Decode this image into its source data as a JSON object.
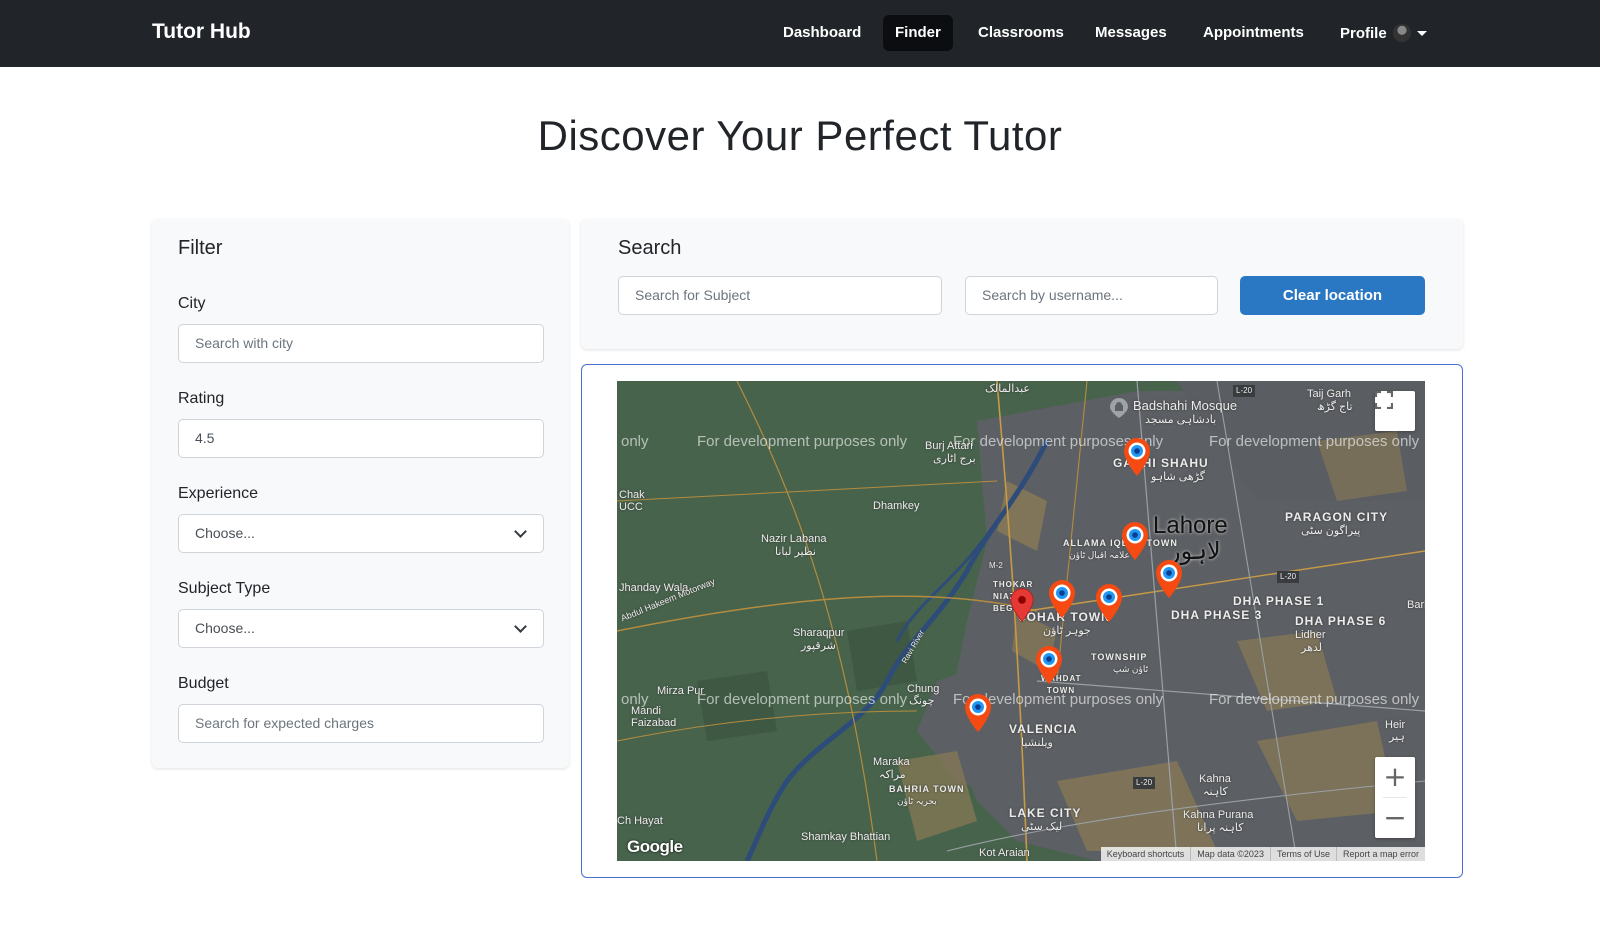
{
  "nav": {
    "brand": "Tutor Hub",
    "links": [
      "Dashboard",
      "Finder",
      "Classrooms",
      "Messages",
      "Appointments"
    ],
    "active": "Finder",
    "profile_label": "Profile"
  },
  "page": {
    "title": "Discover Your Perfect Tutor"
  },
  "filter": {
    "title": "Filter",
    "city": {
      "label": "City",
      "placeholder": "Search with city"
    },
    "rating": {
      "label": "Rating",
      "value": "4.5"
    },
    "experience": {
      "label": "Experience",
      "selected": "Choose..."
    },
    "subject_type": {
      "label": "Subject Type",
      "selected": "Choose..."
    },
    "budget": {
      "label": "Budget",
      "placeholder": "Search for expected charges"
    }
  },
  "search": {
    "title": "Search",
    "subject_placeholder": "Search for Subject",
    "username_placeholder": "Search by username...",
    "clear_button": "Clear location"
  },
  "map": {
    "watermark": "For development purposes only",
    "watermark_fragment": "only",
    "places": {
      "lahore": "Lahore",
      "lahore_urdu": "لاہور",
      "badshahi": "Badshahi Mosque",
      "badshahi_urdu": "بادشاہی مسجد",
      "taij_garh": "Taij Garh",
      "taij_garh_urdu": "تاج گڑھ",
      "abdul_malik": "عبدالمالک",
      "burj_attari": "Burj Attari",
      "burj_urdu": "برج اٹاری",
      "chak": "Chak",
      "ucc": "UCC",
      "dhamkey": "Dhamkey",
      "nazir_labana": "Nazir Labana",
      "nazir_urdu": "نظیر لبانا",
      "jhanday_wala": "Jhanday Wala",
      "motorway": "Abdul Hakeem Motorway",
      "sharaqpur": "Sharaqpur",
      "sharaqpur_urdu": "شرقپور",
      "allama_iqbal": "ALLAMA IQBAL TOWN",
      "allama_urdu": "علامہ اقبال ٹاؤن",
      "thokar": "THOKAR NIAZ BEG",
      "johar_town": "JOHAR TOWN",
      "johar_urdu": "جوہر ٹاؤن",
      "gari_shahu": "GARHI SHAHU",
      "gari_urdu": "گڑھی شاہو",
      "paragon_city": "PARAGON CITY",
      "paragon_urdu": "پیراگون سٹی",
      "dha1": "DHA PHASE 1",
      "dha3": "DHA PHASE 3",
      "dha6": "DHA PHASE 6",
      "lidher": "Lidher",
      "lidher_urdu": "لدھر",
      "township": "TOWNSHIP",
      "township_urdu": "ٹاؤن شپ",
      "wahdat": "WAHDAT TOWN",
      "mirza_pur": "Mirza Pur",
      "mandi_faizabad": "Mandi Faizabad",
      "chung": "Chung",
      "chung_urdu": "چونگ",
      "valencia": "VALENCIA",
      "valencia_urdu": "ویلنشیا",
      "maraka": "Maraka",
      "maraka_urdu": "مراکہ",
      "bahria": "BAHRIA TOWN",
      "bahria_urdu": "بحریہ ٹاؤن",
      "lake_city": "LAKE CITY",
      "lake_city_urdu": "لیک سٹی",
      "kahna": "Kahna",
      "kahna_urdu": "کاہنہ",
      "kahna_purana": "Kahna Purana",
      "kahna_purana_urdu": "کاہنہ پرانا",
      "ch_hayat": "Ch Hayat",
      "shamkay": "Shamkay Bhattian",
      "kot_araian": "Kot Araian",
      "heir": "Heir",
      "heir_urdu": "ہیر",
      "bark": "Bark",
      "m2": "M-2",
      "l20": "L-20",
      "river": "Ravi River"
    },
    "google_logo": "Google",
    "attribution": [
      "Keyboard shortcuts",
      "Map data ©2023",
      "Terms of Use",
      "Report a map error"
    ],
    "zoom_in": "+",
    "zoom_out": "−",
    "pins": [
      {
        "kind": "tutor",
        "color": "#f54a12"
      },
      {
        "kind": "tutor",
        "color": "#f54a12"
      },
      {
        "kind": "tutor",
        "color": "#f54a12"
      },
      {
        "kind": "tutor",
        "color": "#f54a12"
      },
      {
        "kind": "tutor",
        "color": "#f54a12"
      },
      {
        "kind": "tutor",
        "color": "#f54a12"
      },
      {
        "kind": "tutor",
        "color": "#f54a12"
      },
      {
        "kind": "user-location",
        "color": "#e53935"
      }
    ]
  },
  "colors": {
    "navbar": "#212529",
    "primary_button": "#2a78c4",
    "map_frame_border": "#4a6fd0",
    "tutor_pin": "#f54a12"
  }
}
